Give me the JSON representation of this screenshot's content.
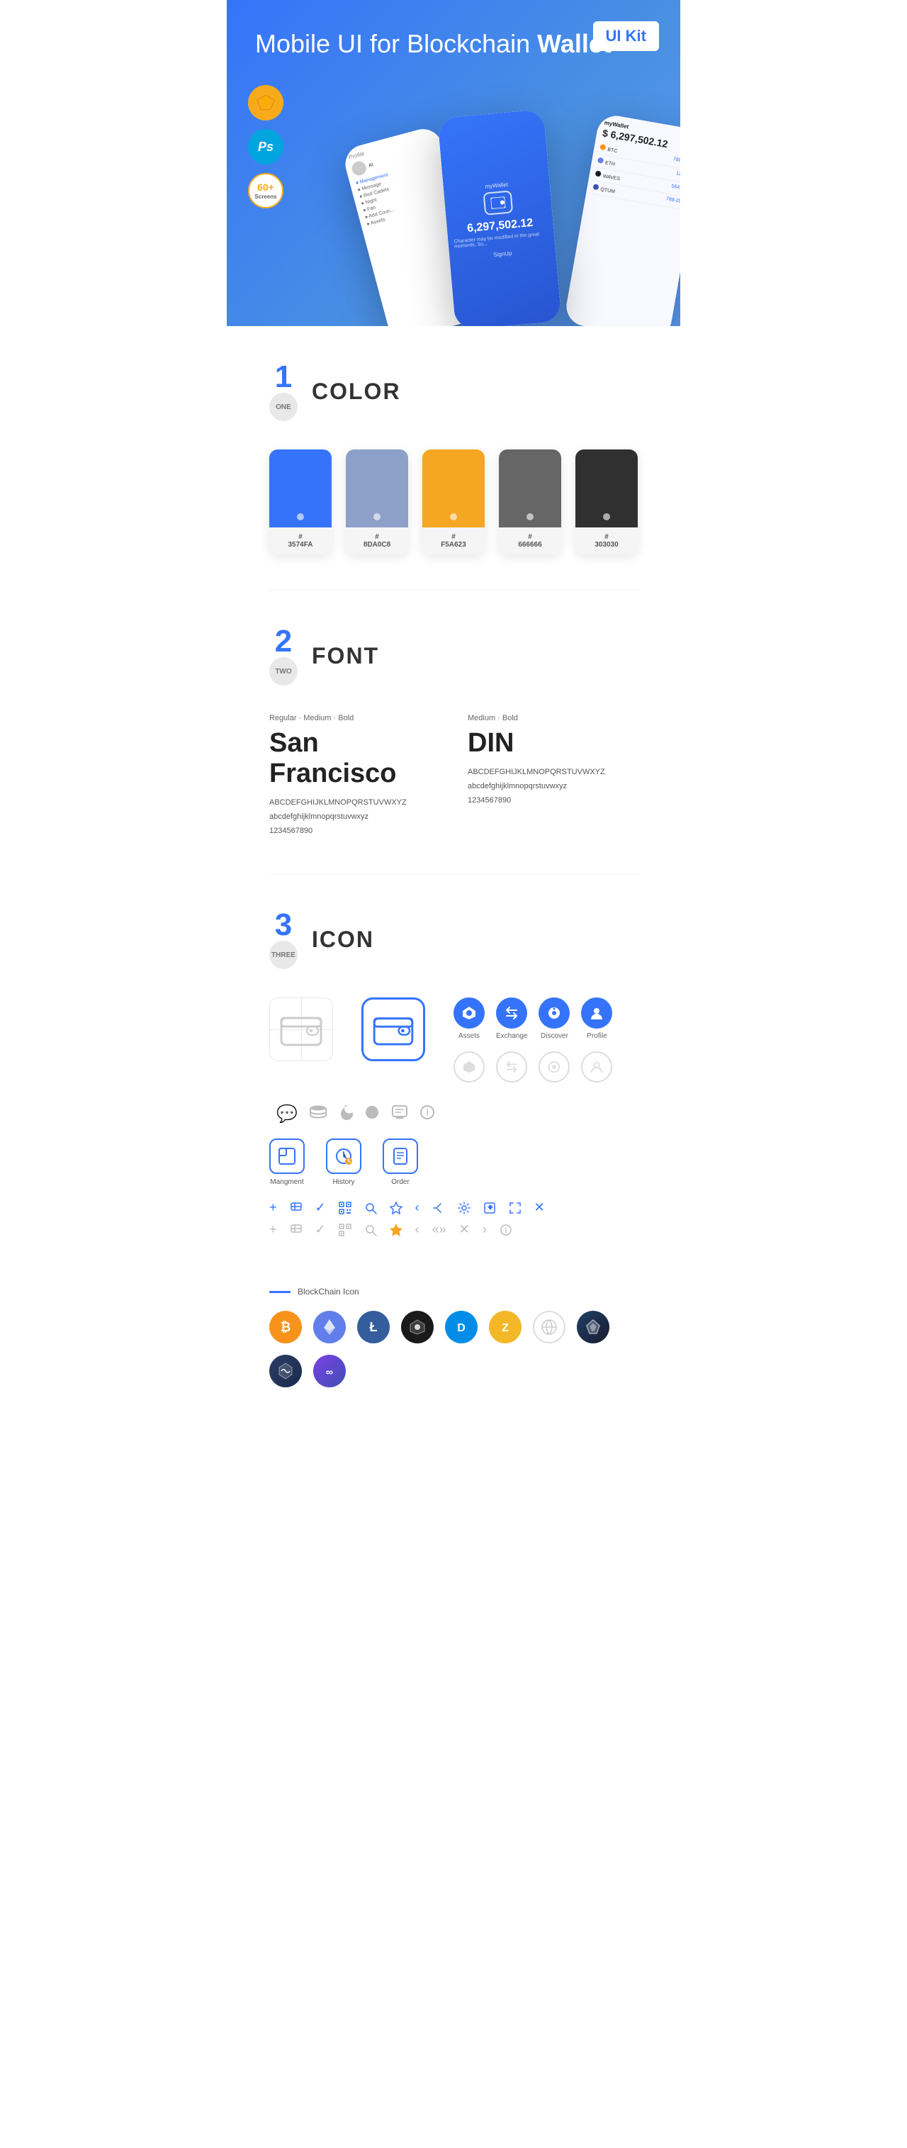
{
  "hero": {
    "title": "Mobile UI for Blockchain ",
    "title_bold": "Wallet",
    "badge": "UI Kit",
    "badges": [
      {
        "label": "Sketch",
        "type": "sketch"
      },
      {
        "label": "Ps",
        "type": "ps"
      },
      {
        "label": "60+\nScreens",
        "type": "screens"
      }
    ]
  },
  "sections": {
    "color": {
      "number": "1",
      "sub": "ONE",
      "title": "COLOR",
      "swatches": [
        {
          "hex": "#3574FA",
          "label": "#\n3574FA"
        },
        {
          "hex": "#8DA0C8",
          "label": "#\n8DA0C8"
        },
        {
          "hex": "#F5A623",
          "label": "#\nF5A623"
        },
        {
          "hex": "#666666",
          "label": "#\n666666"
        },
        {
          "hex": "#303030",
          "label": "#\n303030"
        }
      ]
    },
    "font": {
      "number": "2",
      "sub": "TWO",
      "title": "FONT",
      "fonts": [
        {
          "style": "Regular · Medium · Bold",
          "name": "San Francisco",
          "upper": "ABCDEFGHIJKLMNOPQRSTUVWXYZ",
          "lower": "abcdefghijklmnopqrstuvwxyz",
          "nums": "1234567890"
        },
        {
          "style": "Medium · Bold",
          "name": "DIN",
          "upper": "ABCDEFGHIJKLMNOPQRSTUVWXYZ",
          "lower": "abcdefghijklmnopqrstuvwxyz",
          "nums": "1234567890"
        }
      ]
    },
    "icon": {
      "number": "3",
      "sub": "THREE",
      "title": "ICON",
      "nav_icons": [
        {
          "label": "Assets",
          "color": "#3574FA"
        },
        {
          "label": "Exchange",
          "color": "#3574FA"
        },
        {
          "label": "Discover",
          "color": "#3574FA"
        },
        {
          "label": "Profile",
          "color": "#3574FA"
        }
      ],
      "mgmt_icons": [
        {
          "label": "Mangment"
        },
        {
          "label": "History"
        },
        {
          "label": "Order"
        }
      ]
    },
    "blockchain": {
      "label": "BlockChain Icon",
      "coins": [
        {
          "symbol": "₿",
          "bg": "#F7931A",
          "name": "Bitcoin"
        },
        {
          "symbol": "Ξ",
          "bg": "#627EEA",
          "name": "Ethereum"
        },
        {
          "symbol": "Ł",
          "bg": "#345D9D",
          "name": "Litecoin"
        },
        {
          "symbol": "◈",
          "bg": "#1C1C1C",
          "name": "BlackCoin"
        },
        {
          "symbol": "D",
          "bg": "#008CE7",
          "name": "Dash"
        },
        {
          "symbol": "Z",
          "bg": "#F4B728",
          "name": "Zcash"
        },
        {
          "symbol": "◈",
          "bg": "#1B1B2F",
          "name": "GridCoin"
        },
        {
          "symbol": "▲",
          "bg": "#1F4068",
          "name": "ArkCoin"
        },
        {
          "symbol": "◇",
          "bg": "#2C3E67",
          "name": "Waves"
        },
        {
          "symbol": "∞",
          "bg": "#3F51B5",
          "name": "MATIC"
        }
      ]
    }
  }
}
